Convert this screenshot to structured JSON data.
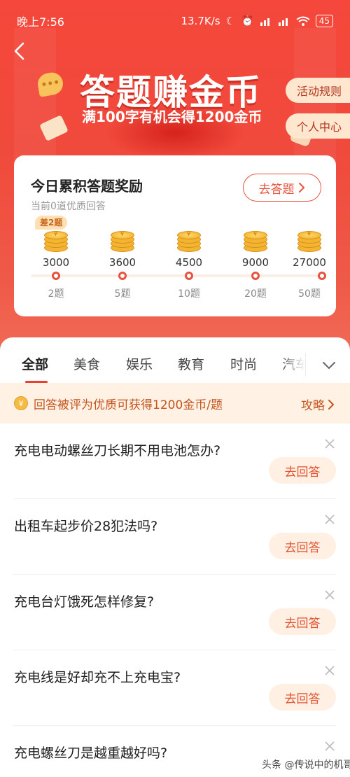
{
  "status_bar": {
    "time": "晚上7:56",
    "net_speed": "13.7K/s",
    "battery": "45"
  },
  "header": {
    "title": "答题赚金币",
    "subtitle": "满100字有机会得1200金币",
    "rules_label": "活动规则",
    "personal_center_label": "个人中心",
    "bubble_glyph": "•••"
  },
  "reward_card": {
    "title": "今日累积答题奖励",
    "subtitle": "当前0道优质回答",
    "go_answer_label": "去答题",
    "gap_badge": "差2题",
    "coin_mark": "¥",
    "milestones": [
      {
        "coins": "3000",
        "count": "2题"
      },
      {
        "coins": "3600",
        "count": "5题"
      },
      {
        "coins": "4500",
        "count": "10题"
      },
      {
        "coins": "9000",
        "count": "20题"
      },
      {
        "coins": "27000",
        "count": "50题"
      }
    ]
  },
  "tabs": [
    {
      "label": "全部",
      "active": true
    },
    {
      "label": "美食",
      "active": false
    },
    {
      "label": "娱乐",
      "active": false
    },
    {
      "label": "教育",
      "active": false
    },
    {
      "label": "时尚",
      "active": false
    },
    {
      "label": "汽车",
      "active": false
    }
  ],
  "tip": {
    "coin_glyph": "¥",
    "text": "回答被评为优质可获得1200金币/题",
    "link_label": "攻略"
  },
  "questions": [
    {
      "title": "充电电动螺丝刀长期不用电池怎办?",
      "action": "去回答"
    },
    {
      "title": "出租车起步价28犯法吗?",
      "action": "去回答"
    },
    {
      "title": "充电台灯饿死怎样修复?",
      "action": "去回答"
    },
    {
      "title": "充电线是好却充不上充电宝?",
      "action": "去回答"
    },
    {
      "title": "充电螺丝刀是越重越好吗?",
      "action": "去回答"
    }
  ],
  "watermark": "头条 @传说中的机哥",
  "colors": {
    "brand_red": "#f04a3c",
    "accent_orange": "#e8533f",
    "tip_background": "#fff1e3",
    "pill_background": "#ffe7cf"
  }
}
